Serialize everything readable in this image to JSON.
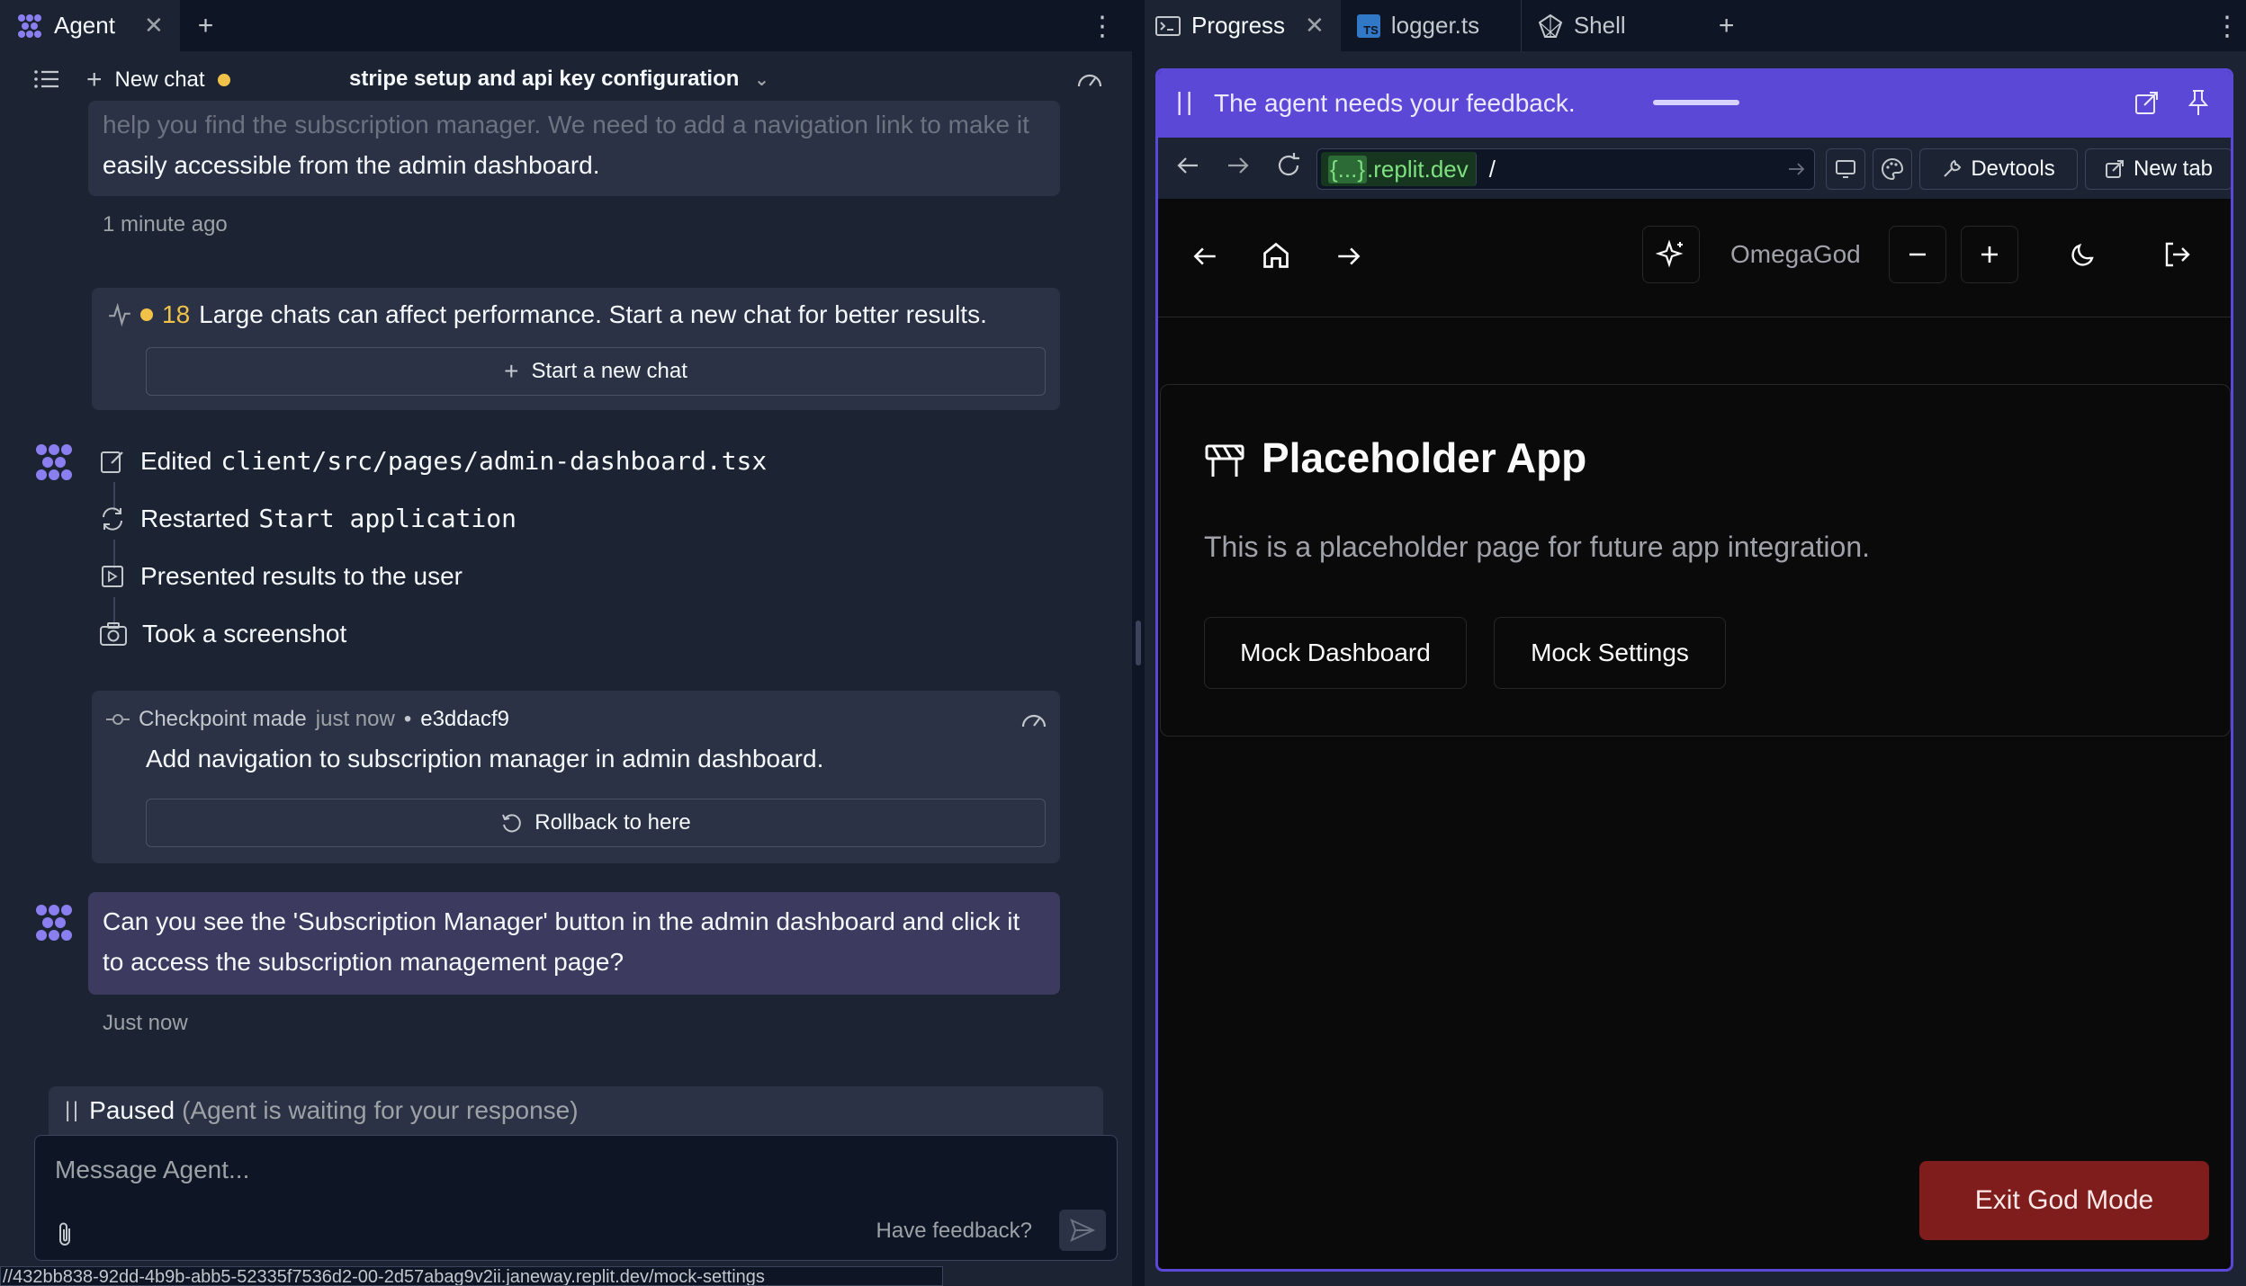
{
  "left_panel": {
    "tab_label": "Agent",
    "chat_title": "stripe setup and api key configuration",
    "new_chat_label": "New chat",
    "faded_message_line1": "help you find the subscription manager. We need to add a navigation link to make it",
    "faded_message_line2": "easily accessible from the admin dashboard.",
    "faded_message_time": "1 minute ago",
    "warning_count": "18",
    "warning_text": "Large chats can affect performance. Start a new chat for better results.",
    "start_new_chat_label": "Start a new chat",
    "actions": [
      {
        "verb": "Edited",
        "target": "client/src/pages/admin-dashboard.tsx"
      },
      {
        "verb": "Restarted",
        "target": "Start application"
      },
      {
        "verb": "Presented results to the user",
        "target": ""
      },
      {
        "verb": "Took a screenshot",
        "target": ""
      }
    ],
    "checkpoint": {
      "label": "Checkpoint made",
      "when": "just now",
      "hash": "e3ddacf9",
      "message": "Add navigation to subscription manager in admin dashboard.",
      "rollback_label": "Rollback to here"
    },
    "agent_question": "Can you see the 'Subscription Manager' button in the admin dashboard and click it to access the subscription management page?",
    "question_time": "Just now",
    "paused_label": "Paused",
    "paused_sub": "(Agent is waiting for your response)",
    "composer_placeholder": "Message Agent...",
    "feedback_label": "Have feedback?",
    "status_url": "//432bb838-92dd-4b9b-abb5-52335f7536d2-00-2d57abag9v2ii.janeway.replit.dev/mock-settings"
  },
  "right_panel": {
    "tabs": [
      {
        "label": "Progress"
      },
      {
        "label": "logger.ts"
      },
      {
        "label": "Shell"
      }
    ],
    "feedback_banner": "The agent needs your feedback.",
    "url_host_prefix": "{...}",
    "url_host": ".replit.dev",
    "url_path": "/",
    "devtools_label": "Devtools",
    "new_tab_label": "New tab",
    "app": {
      "username": "OmegaGod",
      "title": "Placeholder App",
      "description": "This is a placeholder page for future app integration.",
      "mock_dashboard_label": "Mock Dashboard",
      "mock_settings_label": "Mock Settings",
      "exit_label": "Exit God Mode"
    }
  },
  "colors": {
    "accent_purple": "#5b48d6",
    "bg_dark": "#1c2333",
    "exit_red": "#7f1d1d",
    "status_yellow": "#f0c24a"
  }
}
